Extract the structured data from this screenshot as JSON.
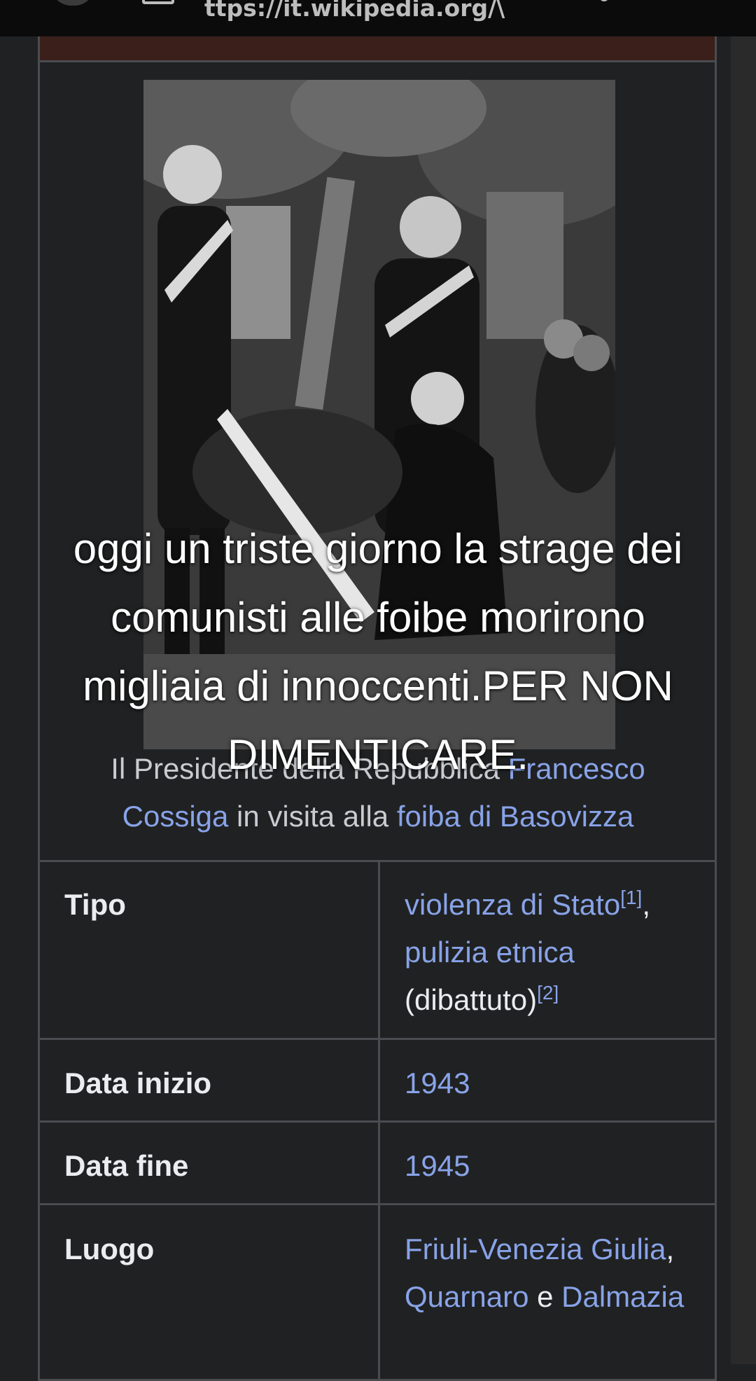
{
  "browser": {
    "url": "ttps://it.wikipedia.org/\\"
  },
  "infobox": {
    "caption": {
      "prefix": "Il Presidente della Repubblica ",
      "link1": "Francesco Cossiga",
      "middle": " in visita alla ",
      "link2": "foiba di Basovizza"
    },
    "rows": [
      {
        "label": "Tipo",
        "value_link1": "violenza di Stato",
        "ref1": "[1]",
        "sep": ",",
        "value_link2": "pulizia etnica",
        "value_text": "(dibattuto)",
        "ref2": "[2]"
      },
      {
        "label": "Data inizio",
        "value_link": "1943"
      },
      {
        "label": "Data fine",
        "value_link": "1945"
      },
      {
        "label": "Luogo",
        "value_link1": "Friuli-Venezia Giulia",
        "sep": ",",
        "value_link2": "Quarnaro",
        "conj": " e ",
        "value_link3": "Dalmazia"
      }
    ]
  },
  "overlay": {
    "text": "oggi un triste giorno la strage dei comunisti alle foibe morirono migliaia di innoccenti.PER NON DIMENTICARE."
  },
  "colors": {
    "background": "#202122",
    "link": "#88a3e8",
    "border": "#4a4c50",
    "text": "#eaecf0"
  }
}
